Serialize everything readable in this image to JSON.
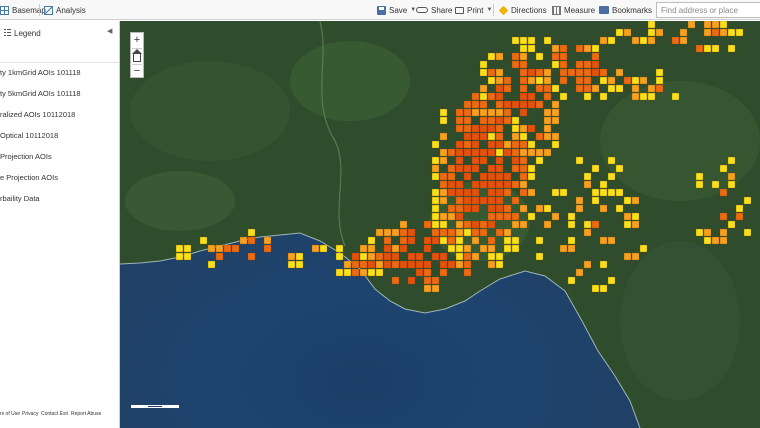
{
  "toolbar": {
    "basemap_label": "Basemap",
    "analysis_label": "Analysis",
    "save_label": "Save",
    "share_label": "Share",
    "print_label": "Print",
    "directions_label": "Directions",
    "measure_label": "Measure",
    "bookmarks_label": "Bookmarks",
    "search_placeholder": "Find address or place",
    "icons": [
      "grid-icon",
      "analysis-icon",
      "save-icon",
      "share-icon",
      "print-icon",
      "directions-icon",
      "measure-icon",
      "bookmark-icon"
    ]
  },
  "sidebar": {
    "legend_label": "Legend",
    "layers": [
      {
        "label": "ty 1kmGrid AOIs 101118"
      },
      {
        "label": "ty 5kmGrid AOIs 101118"
      },
      {
        "label": "ralized AOIs 10112018"
      },
      {
        "label": "Optical 10112018"
      },
      {
        "label": " Projection AOIs"
      },
      {
        "label": "e Projection AOIs"
      },
      {
        "label": "rbaility Data"
      }
    ],
    "footer": {
      "terms": "rs of Use",
      "privacy": "Privacy",
      "contact": "Contact Esri",
      "abuse": "Report Abuse"
    }
  },
  "map": {
    "zoom_in": "+",
    "zoom_out": "−",
    "colors": {
      "land": "#2f4d2c",
      "water": "#1e4470",
      "cell_orange": "#ee6a10",
      "cell_deep": "#e5500a",
      "cell_amber": "#f6a21e",
      "cell_yellow": "#f8e01a"
    }
  }
}
